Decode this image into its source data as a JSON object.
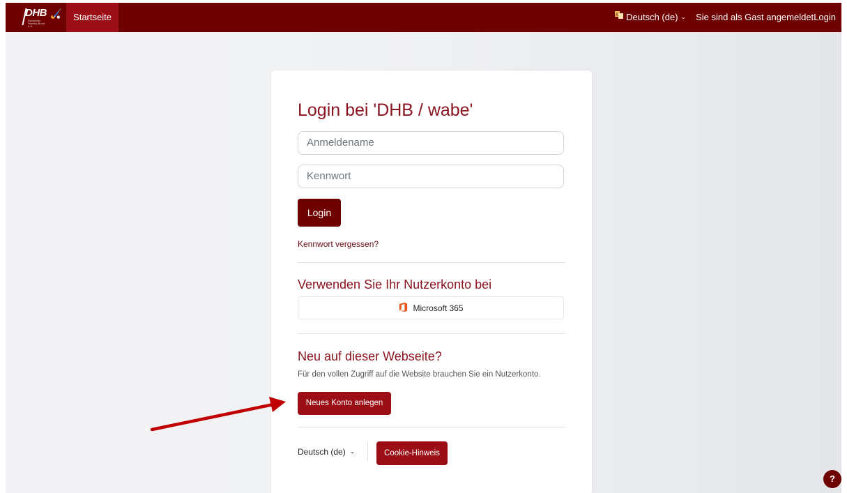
{
  "navbar": {
    "logo_text": "DHB",
    "logo_subtext": "Deutscher Hockey-Bund e.V.",
    "home_label": "Startseite",
    "language_label": "Deutsch (de)",
    "guest_label": "Sie sind als Gast angemeldet",
    "login_label": "Login"
  },
  "card": {
    "title": "Login bei 'DHB / wabe'",
    "username_placeholder": "Anmeldename",
    "password_placeholder": "Kennwort",
    "login_button": "Login",
    "forgot_link": "Kennwort vergessen?",
    "sso_heading": "Verwenden Sie Ihr Nutzerkonto bei",
    "sso_provider": "Microsoft 365",
    "signup_heading": "Neu auf dieser Webseite?",
    "signup_hint": "Für den vollen Zugriff auf die Website brauchen Sie ein Nutzerkonto.",
    "signup_button": "Neues Konto anlegen",
    "footer_language": "Deutsch (de)",
    "cookie_button": "Cookie-Hinweis"
  },
  "help_label": "?",
  "colors": {
    "brand_dark": "#6e0000",
    "brand": "#9c0e16",
    "heading": "#8b1520",
    "arrow": "#c00000"
  },
  "icons": {
    "language": "translate-icon",
    "chevron": "chevron-down-icon",
    "office": "microsoft-office-icon",
    "help": "question-mark-icon"
  }
}
